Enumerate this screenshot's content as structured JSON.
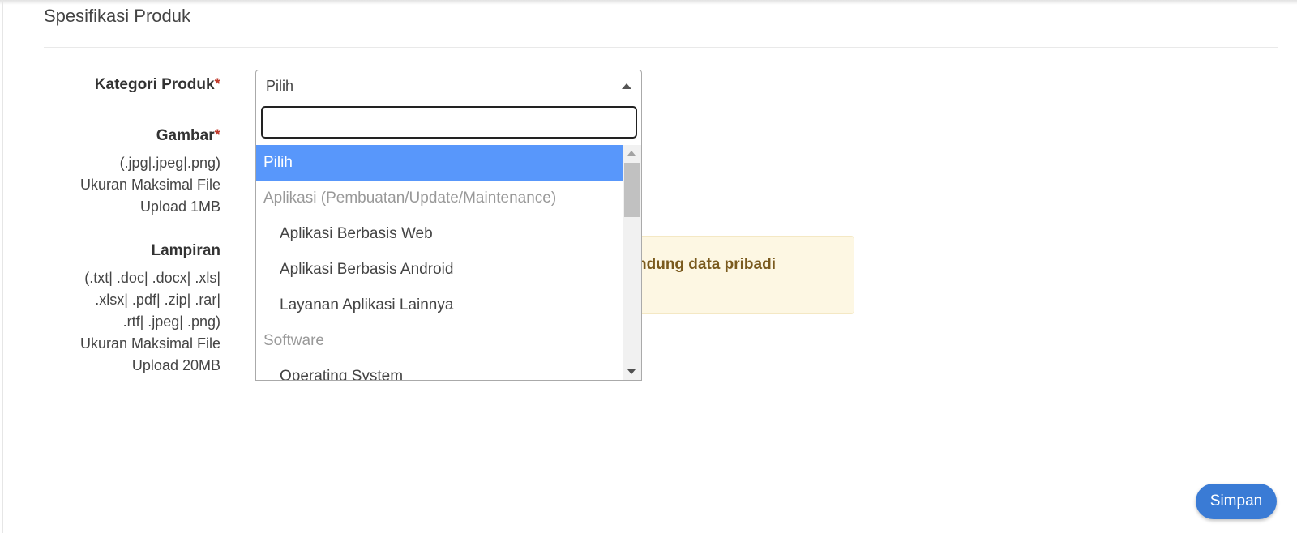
{
  "section": {
    "title": "Spesifikasi Produk"
  },
  "form": {
    "category_label": "Kategori Produk",
    "image_label": "Gambar",
    "image_hint": [
      "(.jpg|.jpeg|.png)",
      "Ukuran Maksimal File",
      "Upload 1MB"
    ],
    "attachment_label": "Lampiran",
    "attachment_hint": [
      "(.txt| .doc| .docx| .xls|",
      ".xlsx| .pdf| .zip| .rar|",
      ".rtf| .jpeg| .png)",
      "Ukuran Maksimal File",
      "Upload 20MB"
    ],
    "required_mark": "*"
  },
  "select": {
    "value": "Pilih",
    "search_value": "",
    "options": [
      {
        "label": "Pilih",
        "type": "selected"
      },
      {
        "label": "Aplikasi (Pembuatan/Update/Maintenance)",
        "type": "group"
      },
      {
        "label": "Aplikasi Berbasis Web",
        "type": "child"
      },
      {
        "label": "Aplikasi Berbasis Android",
        "type": "child"
      },
      {
        "label": "Layanan Aplikasi Lainnya",
        "type": "child"
      },
      {
        "label": "Software",
        "type": "group"
      },
      {
        "label": "Operating System",
        "type": "child"
      }
    ]
  },
  "warning": {
    "text": "ndung data pribadi"
  },
  "actions": {
    "save_label": "Simpan"
  },
  "colors": {
    "selected_option": "#5897fb",
    "save_button": "#3a7bd5",
    "required": "#c0392b"
  }
}
